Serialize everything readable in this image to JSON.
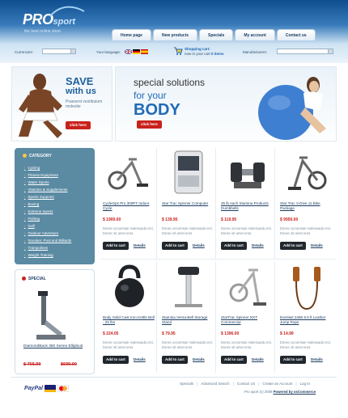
{
  "header": {
    "logo_pro": "PRO",
    "logo_sport": "sport",
    "tagline": "the best online store",
    "nav": [
      "Home page",
      "New products",
      "Specials",
      "My account",
      "Contact us"
    ]
  },
  "toolbar": {
    "currencies_label": "Currencies:",
    "language_label": "Your language:",
    "cart_label": "Shopping cart:",
    "cart_text": "now in your cart",
    "cart_count": "0 items",
    "manufacturers_label": "Manufacturers:"
  },
  "banner_left": {
    "title1": "SAVE",
    "title2": "with us",
    "promo": "Praesent vestibulum molestie",
    "button": "click here"
  },
  "banner_right": {
    "line1": "special solutions",
    "line2": "for your",
    "line3": "BODY",
    "button": "click here"
  },
  "categories": {
    "title": "CATEGORY",
    "items": [
      "Cycling",
      "Fitness Equipment",
      "Water Sports",
      "Vitamins & Supplements",
      "Sports Supports",
      "Boxing",
      "Extreme Sports",
      "Fishing",
      "Golf",
      "Outdoor Adventure",
      "Snooker, Pool and Billiards",
      "Trampolines",
      "Weight Training"
    ]
  },
  "specials": {
    "title": "SPECIAL",
    "name": "DiamondBack 360 Series Elliptical",
    "old_price": "$ 765.99",
    "new_price": "$699.00"
  },
  "products": [
    {
      "name": "CycleOps Pro 300PT Indoor Cycle",
      "price": "$ 1900.00",
      "desc": "Donec accumsan malesuada orci. Donec sit amet eros.",
      "add": "Add to cart",
      "details": "Details"
    },
    {
      "name": "Star Trac Spinner Computer",
      "price": "$ 139.95",
      "desc": "Donec accumsan malesuada orci. Donec sit amet eros.",
      "add": "Add to cart",
      "details": "Details"
    },
    {
      "name": "25 lb each Stamina Products Dumbbells",
      "price": "$ 119.95",
      "desc": "Donec accumsan malesuada orci. Donec sit amet eros.",
      "add": "Add to cart",
      "details": "Details"
    },
    {
      "name": "Star Trac V-Dive 11 Bike Package",
      "price": "$ 9950.00",
      "desc": "Donec accumsan malesuada orci. Donec sit amet eros.",
      "add": "Add to cart",
      "details": "Details"
    },
    {
      "name": "Body Solid Cast Iron Kettle Bell - 25 lbs",
      "price": "$ 224.05",
      "desc": "Donec accumsan malesuada orci. Donec sit amet eros.",
      "add": "Add to cart",
      "details": "Details"
    },
    {
      "name": "Stamina Versa-Bell Storage Stand",
      "price": "$ 79.95",
      "desc": "Donec accumsan malesuada orci. Donec sit amet eros.",
      "add": "Add to cart",
      "details": "Details"
    },
    {
      "name": "StarTrac Spinner NXT Commercial",
      "price": "$ 1396.00",
      "desc": "Donec accumsan malesuada orci. Donec sit amet eros.",
      "add": "Add to cart",
      "details": "Details"
    },
    {
      "name": "Everlast 2465 9.5 ft Leather Jump Rope",
      "price": "$ 14.99",
      "desc": "Donec accumsan malesuada orci. Donec sit amet eros.",
      "add": "Add to cart",
      "details": "Details"
    }
  ],
  "footer": {
    "paypal": "PayPal",
    "links": [
      "Specials",
      "Advanced Search",
      "Contact Us",
      "Create an Account",
      "Log In"
    ],
    "copyright": "Pro sport (c) 2009",
    "powered": "Powered by osCommerce"
  }
}
